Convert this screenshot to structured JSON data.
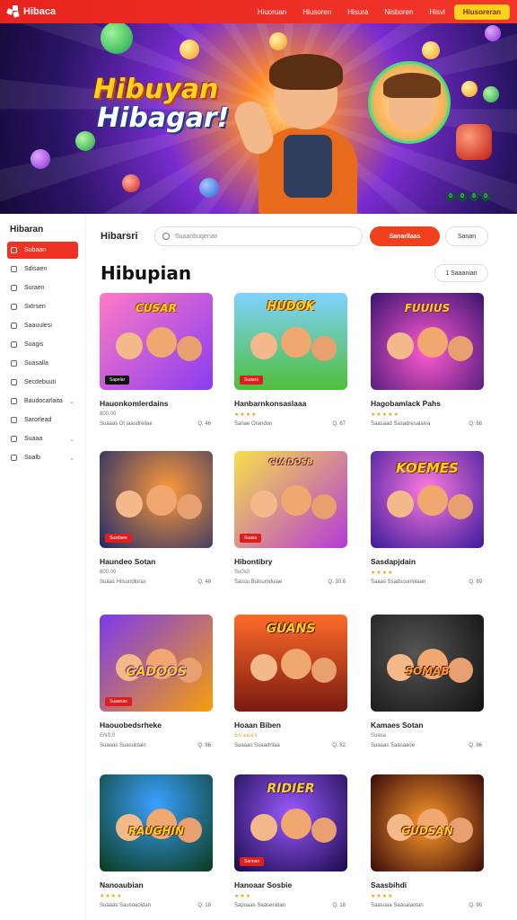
{
  "header": {
    "brand": "Hibaca",
    "nav": [
      "Hiuoruan",
      "Hiusoren",
      "Hisura",
      "Nisboren",
      "Hisvl"
    ],
    "cta": "Hiusoreran"
  },
  "hero": {
    "title_line1": "Hibuyan",
    "title_line2": "Hibagar!",
    "controls": [
      "0",
      "0",
      "0",
      "0"
    ]
  },
  "sidebar": {
    "title": "Hibaran",
    "items": [
      {
        "label": "Subaan",
        "active": true,
        "chevron": ""
      },
      {
        "label": "Sdisaen",
        "active": false,
        "chevron": ""
      },
      {
        "label": "Suraen",
        "active": false,
        "chevron": ""
      },
      {
        "label": "Sxtrsen",
        "active": false,
        "chevron": ""
      },
      {
        "label": "Saauulesi",
        "active": false,
        "chevron": ""
      },
      {
        "label": "Suagis",
        "active": false,
        "chevron": ""
      },
      {
        "label": "Suasalla",
        "active": false,
        "chevron": ""
      },
      {
        "label": "Secdebuuti",
        "active": false,
        "chevron": ""
      },
      {
        "label": "Baudocarlaita",
        "active": false,
        "chevron": "⌄"
      },
      {
        "label": "Sarorlead",
        "active": false,
        "chevron": ""
      },
      {
        "label": "Suaaa",
        "active": false,
        "chevron": "⌄"
      },
      {
        "label": "Soalb",
        "active": false,
        "chevron": "⌄"
      }
    ]
  },
  "toolbar": {
    "title": "Hibarsri",
    "search_placeholder": "Suaanbuqenan",
    "primary_button": "Sanarllaas",
    "secondary_button": "Sanan"
  },
  "section": {
    "title": "Hibupian",
    "sort_label": "1 Saaanian"
  },
  "cards": [
    {
      "name": "Hauonkomlerdains",
      "sub": "800.00",
      "stars": false,
      "meta_left": "Suaaas Dt iaasdreilae",
      "meta_right": "Q. 46",
      "thumb_title": "CUSAR",
      "tag": "Sapelar"
    },
    {
      "name": "Hanbarnkonsaslaaa",
      "sub": "★★★★",
      "stars": true,
      "meta_left": "Sanae Orandon",
      "meta_right": "Q. 67",
      "thumb_title": "HUDOK",
      "tag": "Suaars"
    },
    {
      "name": "Hagobamlack Pahs",
      "sub": "★★★★★",
      "stars": true,
      "meta_left": "Saasaad Sasadresalaiva",
      "meta_right": "Q. 68",
      "thumb_title": "FUUIUS",
      "tag": ""
    },
    {
      "name": "Haundeo Sotan",
      "sub": "800.00",
      "stars": false,
      "meta_left": "Suaas Hilsundloras",
      "meta_right": "Q. 48",
      "thumb_title": "",
      "tag": "Susdaee"
    },
    {
      "name": "Hibontibry",
      "sub": "Su0s0",
      "stars": false,
      "meta_left": "Sasou Bulsumduiae",
      "meta_right": "Q. 30.6",
      "thumb_title": "CUADOSB",
      "tag": "Suasa"
    },
    {
      "name": "Sasdapjdain",
      "sub": "★★★★",
      "stars": true,
      "meta_left": "Saaas Ssadsounlolaan",
      "meta_right": "Q. 89",
      "thumb_title": "KOEMES",
      "tag": ""
    },
    {
      "name": "Haouobedsrheke",
      "sub": "ENS.0",
      "stars": false,
      "meta_left": "Suauas Suasuldain",
      "meta_right": "Q. 86",
      "thumb_title": "GADOOS",
      "tag": "Suaanas"
    },
    {
      "name": "Hoaan Biben",
      "sub": "Suaaas",
      "stars": true,
      "meta_left": "Suaaas Suaadrllaa",
      "meta_right": "Q. 82",
      "thumb_title": "GUANS",
      "tag": ""
    },
    {
      "name": "Kamaes Sotan",
      "sub": "Suasa",
      "stars": false,
      "meta_left": "Suaaas Saasaaoe",
      "meta_right": "Q. 86",
      "thumb_title": "SOMAB",
      "tag": ""
    },
    {
      "name": "Nanoaubian",
      "sub": "★★★★",
      "stars": true,
      "meta_left": "Suaaas Sausoaoidan",
      "meta_right": "Q. 18",
      "thumb_title": "RAUGHIN",
      "tag": ""
    },
    {
      "name": "Hanoaar Sosbie",
      "sub": "★★★",
      "stars": true,
      "meta_left": "Sapoaas Saasenidan",
      "meta_right": "Q. 18",
      "thumb_title": "RIDIER",
      "tag": "Sannan"
    },
    {
      "name": "Saasbihdi",
      "sub": "★★★★",
      "stars": true,
      "meta_left": "Saasuaa Saasalaotan",
      "meta_right": "Q. 90",
      "thumb_title": "GUDSAN",
      "tag": ""
    }
  ]
}
